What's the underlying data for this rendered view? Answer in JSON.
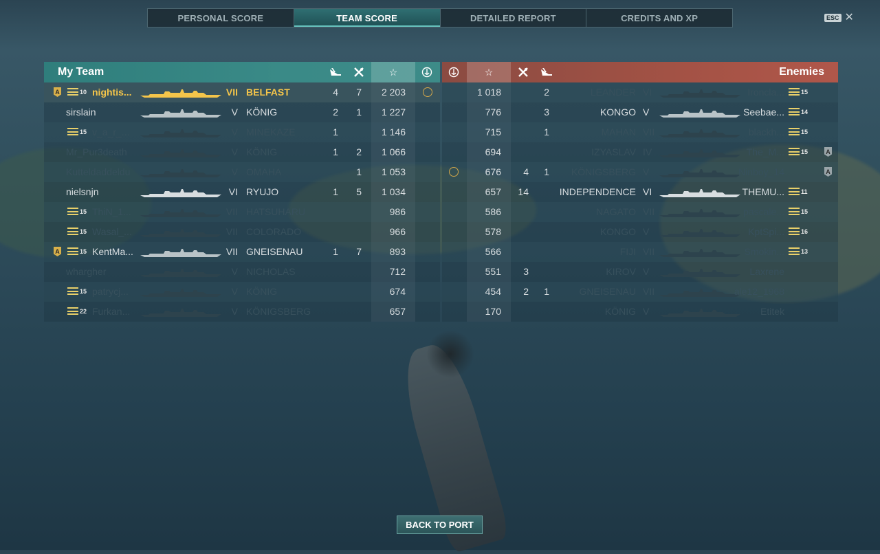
{
  "tabs": [
    {
      "label": "PERSONAL SCORE",
      "active": false
    },
    {
      "label": "TEAM SCORE",
      "active": true
    },
    {
      "label": "DETAILED REPORT",
      "active": false
    },
    {
      "label": "CREDITS AND XP",
      "active": false
    }
  ],
  "esc_label": "ESC",
  "close_glyph": "✕",
  "my_team": {
    "title": "My Team",
    "header_icons": [
      "plane-kill-icon",
      "kill-icon",
      "star-icon",
      "base-capture-icon"
    ],
    "rows": [
      {
        "badge": "A",
        "rank": "10",
        "player": "nightis...",
        "tier": "VII",
        "ship": "BELFAST",
        "planes": "4",
        "kills": "7",
        "score": "2 203",
        "capture": "anchor",
        "highlight": "self",
        "dim": false
      },
      {
        "badge": "",
        "rank": "",
        "player": "sirslain",
        "tier": "V",
        "ship": "KÖNIG",
        "planes": "2",
        "kills": "1",
        "score": "1 227",
        "capture": "",
        "dim": false
      },
      {
        "badge": "",
        "rank": "15",
        "player": "v_a_r_...",
        "tier": "V",
        "ship": "MINEKAZE",
        "planes": "1",
        "kills": "",
        "score": "1 146",
        "capture": "",
        "dim": true
      },
      {
        "badge": "",
        "rank": "",
        "player": "Mr_Pur3death",
        "tier": "V",
        "ship": "KÖNIG",
        "planes": "1",
        "kills": "2",
        "score": "1 066",
        "capture": "",
        "dim": true
      },
      {
        "badge": "",
        "rank": "",
        "player": "Kutteldaddeldu",
        "tier": "V",
        "ship": "OMAHA",
        "planes": "",
        "kills": "1",
        "score": "1 053",
        "capture": "",
        "dim": true
      },
      {
        "badge": "",
        "rank": "",
        "player": "nielsnjn",
        "tier": "VI",
        "ship": "RYUJO",
        "planes": "1",
        "kills": "5",
        "score": "1 034",
        "capture": "",
        "dim": false
      },
      {
        "badge": "",
        "rank": "15",
        "player": "ThiN_1...",
        "tier": "VII",
        "ship": "HATSUHARU",
        "planes": "",
        "kills": "",
        "score": "986",
        "capture": "",
        "dim": true
      },
      {
        "badge": "",
        "rank": "15",
        "player": "Wasal_...",
        "tier": "VII",
        "ship": "COLORADO",
        "planes": "",
        "kills": "",
        "score": "966",
        "capture": "",
        "dim": true
      },
      {
        "badge": "A",
        "rank": "15",
        "player": "KentMa...",
        "tier": "VII",
        "ship": "GNEISENAU",
        "planes": "1",
        "kills": "7",
        "score": "893",
        "capture": "",
        "dim": false
      },
      {
        "badge": "",
        "rank": "",
        "player": "whargher",
        "tier": "V",
        "ship": "NICHOLAS",
        "planes": "",
        "kills": "",
        "score": "712",
        "capture": "",
        "dim": true
      },
      {
        "badge": "",
        "rank": "15",
        "player": "patrycj...",
        "tier": "V",
        "ship": "KÖNIG",
        "planes": "",
        "kills": "",
        "score": "674",
        "capture": "",
        "dim": true
      },
      {
        "badge": "",
        "rank": "22",
        "player": "Furkan...",
        "tier": "V",
        "ship": "KÖNIGSBERG",
        "planes": "",
        "kills": "",
        "score": "657",
        "capture": "",
        "dim": true
      }
    ]
  },
  "enemies": {
    "title": "Enemies",
    "header_icons": [
      "base-capture-icon",
      "star-icon",
      "kill-icon",
      "plane-kill-icon"
    ],
    "rows": [
      {
        "capture": "",
        "score": "1 018",
        "kills": "",
        "planes": "2",
        "ship": "LEANDER",
        "tier": "VI",
        "player": "Ironcla...",
        "rank": "15",
        "badge": "",
        "dim": true
      },
      {
        "capture": "",
        "score": "776",
        "kills": "",
        "planes": "3",
        "ship": "KONGO",
        "tier": "V",
        "player": "Seebae...",
        "rank": "14",
        "badge": "",
        "dim": false
      },
      {
        "capture": "",
        "score": "715",
        "kills": "",
        "planes": "1",
        "ship": "MAHAN",
        "tier": "VII",
        "player": "blackh...",
        "rank": "15",
        "badge": "",
        "dim": true
      },
      {
        "capture": "",
        "score": "694",
        "kills": "",
        "planes": "",
        "ship": "IZYASLAV",
        "tier": "IV",
        "player": "The_M...",
        "rank": "15",
        "badge": "A",
        "dim": true
      },
      {
        "capture": "anchor",
        "score": "676",
        "kills": "4",
        "planes": "1",
        "ship": "KÖNIGSBERG",
        "tier": "V",
        "player": "Ninboy_14",
        "rank": "",
        "badge": "A",
        "dim": true
      },
      {
        "capture": "",
        "score": "657",
        "kills": "14",
        "planes": "",
        "ship": "INDEPENDENCE",
        "tier": "VI",
        "player": "THEMU...",
        "rank": "11",
        "badge": "",
        "dim": false
      },
      {
        "capture": "",
        "score": "586",
        "kills": "",
        "planes": "",
        "ship": "NAGATO",
        "tier": "VII",
        "player": "pascale...",
        "rank": "15",
        "badge": "",
        "dim": true
      },
      {
        "capture": "",
        "score": "578",
        "kills": "",
        "planes": "",
        "ship": "KONGO",
        "tier": "V",
        "player": "KptSpi...",
        "rank": "16",
        "badge": "",
        "dim": true
      },
      {
        "capture": "",
        "score": "566",
        "kills": "",
        "planes": "",
        "ship": "FIJI",
        "tier": "VII",
        "player": "Smokin...",
        "rank": "13",
        "badge": "",
        "dim": true
      },
      {
        "capture": "",
        "score": "551",
        "kills": "3",
        "planes": "",
        "ship": "KIROV",
        "tier": "V",
        "player": "Laxrene",
        "rank": "",
        "badge": "",
        "dim": true
      },
      {
        "capture": "",
        "score": "454",
        "kills": "2",
        "planes": "1",
        "ship": "GNEISENAU",
        "tier": "VII",
        "player": "ale12_1968",
        "rank": "",
        "badge": "",
        "dim": true
      },
      {
        "capture": "",
        "score": "170",
        "kills": "",
        "planes": "",
        "ship": "KÖNIG",
        "tier": "V",
        "player": "Etitek",
        "rank": "",
        "badge": "",
        "dim": true
      }
    ]
  },
  "back_button": "BACK TO PORT",
  "colors": {
    "ally_header": "#3a8a87",
    "enemy_header": "#a35245",
    "highlight_gold": "#f4c54a",
    "dim_text": "#37505c"
  }
}
